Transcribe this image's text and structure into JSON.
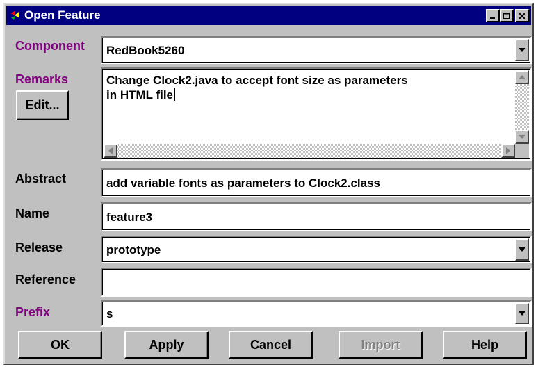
{
  "window": {
    "title": "Open Feature"
  },
  "fields": {
    "component": {
      "label": "Component",
      "value": "RedBook5260"
    },
    "remarks": {
      "label": "Remarks",
      "edit_button": "Edit...",
      "line1": "Change Clock2.java to accept font size as parameters",
      "line2": "in HTML file"
    },
    "abstract": {
      "label": "Abstract",
      "value": "add variable fonts as parameters to Clock2.class"
    },
    "name": {
      "label": "Name",
      "value": "feature3"
    },
    "release": {
      "label": "Release",
      "value": "prototype"
    },
    "reference": {
      "label": "Reference",
      "value": ""
    },
    "prefix": {
      "label": "Prefix",
      "value": "s"
    }
  },
  "buttons": {
    "ok": "OK",
    "apply": "Apply",
    "cancel": "Cancel",
    "import": "Import",
    "help": "Help"
  },
  "colors": {
    "titlebar": "#000080",
    "label_highlight": "#800080",
    "face": "#c0c0c0"
  }
}
